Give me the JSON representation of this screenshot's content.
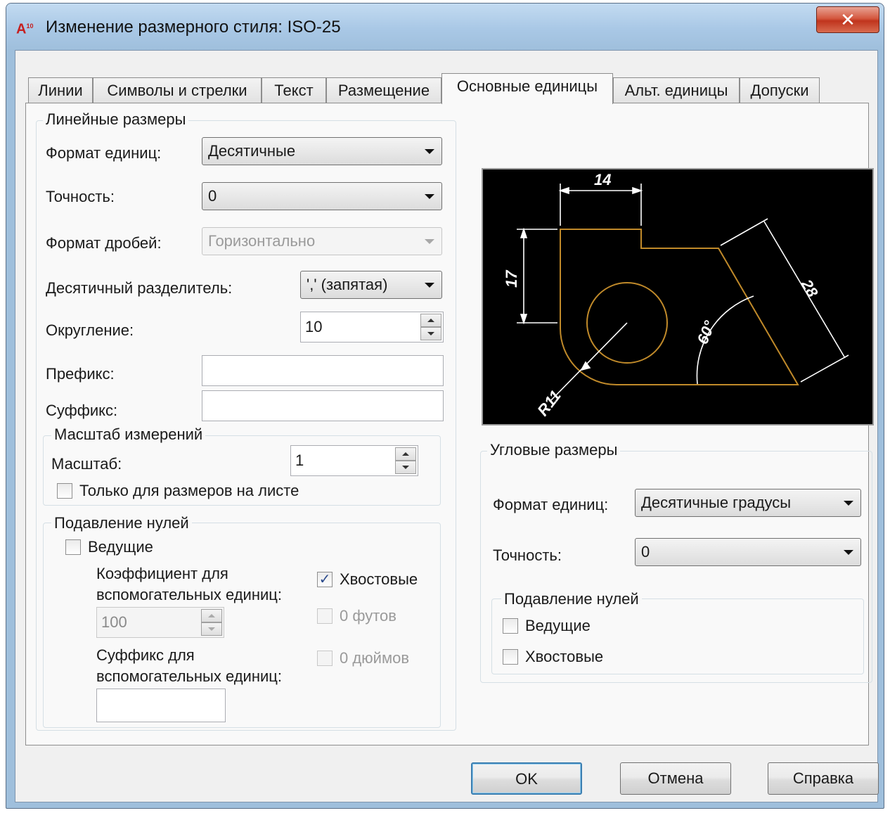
{
  "window": {
    "title": "Изменение размерного стиля: ISO-25",
    "app_icon_text": "A",
    "app_icon_badge": "10",
    "close_glyph": "✕"
  },
  "tabs": [
    {
      "label": "Линии"
    },
    {
      "label": "Символы и стрелки"
    },
    {
      "label": "Текст"
    },
    {
      "label": "Размещение"
    },
    {
      "label": "Основные единицы",
      "active": true
    },
    {
      "label": "Альт. единицы"
    },
    {
      "label": "Допуски"
    }
  ],
  "linear": {
    "legend": "Линейные размеры",
    "unit_format_label": "Формат единиц:",
    "unit_format_value": "Десятичные",
    "precision_label": "Точность:",
    "precision_value": "0",
    "fraction_format_label": "Формат дробей:",
    "fraction_format_value": "Горизонтально",
    "decimal_separator_label": "Десятичный  разделитель:",
    "decimal_separator_value": "',' (запятая)",
    "rounding_label": "Округление:",
    "rounding_value": "10",
    "prefix_label": "Префикс:",
    "prefix_value": "",
    "suffix_label": "Суффикс:",
    "suffix_value": ""
  },
  "measurement_scale": {
    "legend": "Масштаб измерений",
    "scale_label": "Масштаб:",
    "scale_value": "1",
    "layout_only_label": "Только для размеров на листе",
    "layout_only_checked": false
  },
  "zero_suppression_linear": {
    "legend": "Подавление нулей",
    "leading_label": "Ведущие",
    "leading_checked": false,
    "subunit_factor_label_1": "Коэффициент для",
    "subunit_factor_label_2": "вспомогательных единиц:",
    "subunit_factor_value": "100",
    "subunit_suffix_label_1": "Суффикс для",
    "subunit_suffix_label_2": "вспомогательных единиц:",
    "subunit_suffix_value": "",
    "trailing_label": "Хвостовые",
    "trailing_checked": true,
    "zero_feet_label": "0 футов",
    "zero_inches_label": "0 дюймов",
    "check_glyph": "✓"
  },
  "preview": {
    "dim_top": "14",
    "dim_left": "17",
    "dim_diag": "28",
    "dim_angle": "60°",
    "dim_radius": "R11",
    "colors": {
      "background": "#000000",
      "geometry": "#c08a2a",
      "dimensions": "#ffffff"
    }
  },
  "angular": {
    "legend": "Угловые размеры",
    "unit_format_label": "Формат единиц:",
    "unit_format_value": "Десятичные градусы",
    "precision_label": "Точность:",
    "precision_value": "0"
  },
  "zero_suppression_angular": {
    "legend": "Подавление нулей",
    "leading_label": "Ведущие",
    "leading_checked": false,
    "trailing_label": "Хвостовые",
    "trailing_checked": false
  },
  "buttons": {
    "ok": "OK",
    "cancel": "Отмена",
    "help": "Справка"
  }
}
